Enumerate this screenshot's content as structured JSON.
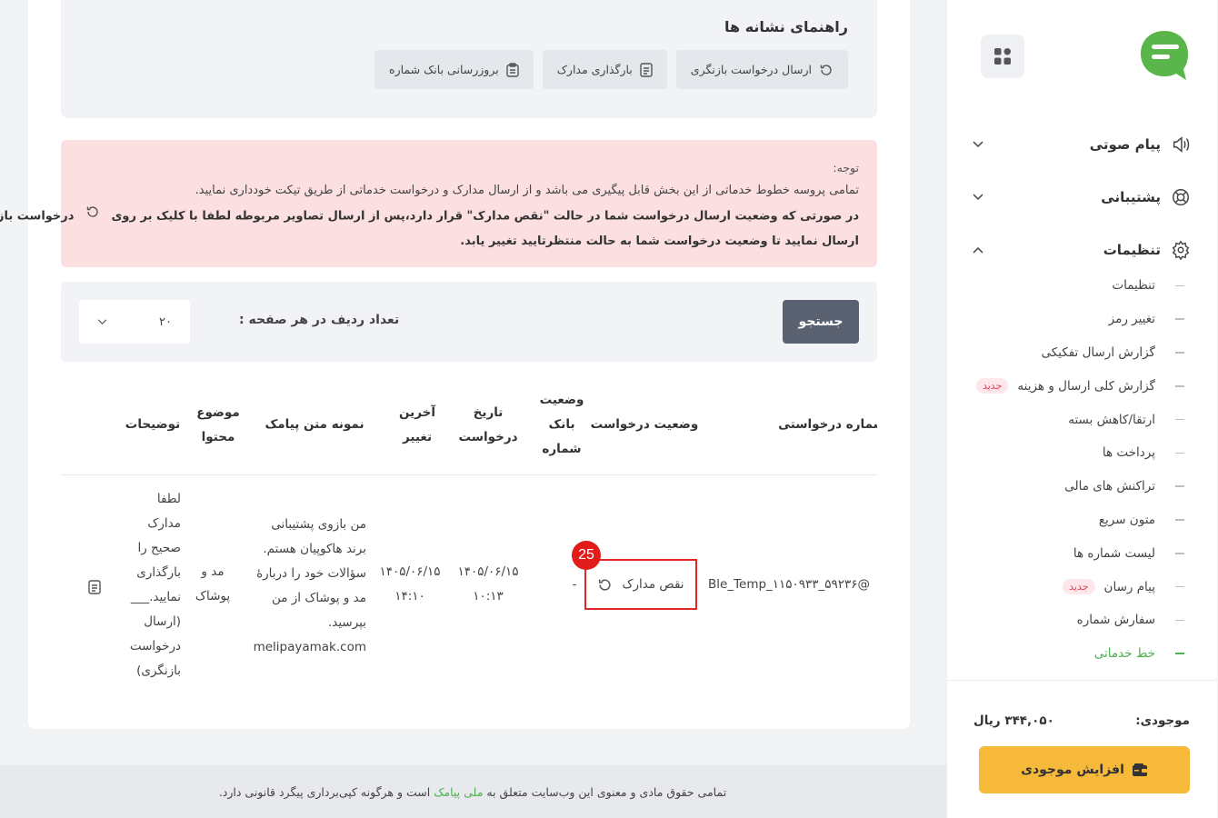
{
  "sidebar": {
    "menu": [
      {
        "label": "پیام صوتی",
        "icon": "speaker-icon"
      },
      {
        "label": "پشتیبانی",
        "icon": "lifebuoy-icon"
      },
      {
        "label": "تنظیمات",
        "icon": "gear-icon"
      }
    ],
    "submenu": [
      {
        "label": "تنظیمات"
      },
      {
        "label": "تغییر رمز"
      },
      {
        "label": "گزارش ارسال تفکیکی"
      },
      {
        "label": "گزارش کلی ارسال و هزینه",
        "badge": "جدید"
      },
      {
        "label": "ارتقا/کاهش بسته"
      },
      {
        "label": "پرداخت ها"
      },
      {
        "label": "تراکنش های مالی"
      },
      {
        "label": "متون سریع"
      },
      {
        "label": "لیست شماره ها"
      },
      {
        "label": "پیام رسان",
        "badge": "جدید"
      },
      {
        "label": "سفارش شماره"
      },
      {
        "label": "خط خدماتی",
        "active": true
      }
    ],
    "balance_label": "موجودی:",
    "balance_value": "۳۴۴,۰۵۰ ریال",
    "topup_label": "افزایش موجودی"
  },
  "guide": {
    "title": "راهنمای نشانه ها",
    "buttons": [
      {
        "label": "ارسال درخواست بازنگری",
        "icon": "refresh-icon"
      },
      {
        "label": "بارگذاری مدارک",
        "icon": "document-icon"
      },
      {
        "label": "بروزرسانی بانک شماره",
        "icon": "clipboard-icon"
      }
    ]
  },
  "alert": {
    "title": "توجه:",
    "line1": "تمامی پروسه خطوط خدماتی از این بخش قابل پیگیری می باشد و از ارسال مدارک و درخواست خدماتی از طریق تیکت خودداری نمایید.",
    "line2a": "در صورتی که وضعیت ارسال درخواست شما در حالت \"نقص مدارک\" قرار دارد،پس از ارسال تصاویر مربوطه لطفا با کلیک بر روی",
    "line2b": "درخواست بازنگری را",
    "line3": "ارسال نمایید تا وضعیت درخواست شما به حالت منتظرتایید تغییر یابد."
  },
  "filter": {
    "search_label": "جستجو",
    "rows_label": "تعداد ردیف در هر صفحه :",
    "rows_value": "۲۰"
  },
  "table": {
    "headers": {
      "request_no": "شماره درخواستی",
      "status": "وضعیت درخواست",
      "bank_status_1": "وضعیت",
      "bank_status_2": "بانک",
      "bank_status_3": "شماره",
      "req_date_1": "تاریخ",
      "req_date_2": "درخواست",
      "last_change_1": "آخرین",
      "last_change_2": "تغییر",
      "sample_text": "نمونه متن پیامک",
      "subject_1": "موضوع",
      "subject_2": "محتوا",
      "notes": "توضیحات"
    },
    "row": {
      "request_no": "Ble_Temp_۱۱۵۰۹۳۳_۵۹۲۳۶@",
      "status": "نقص مدارک",
      "bank_status": "-",
      "req_date_1": "۱۴۰۵/۰۶/۱۵",
      "req_date_2": "۱۰:۱۳",
      "last_change_1": "۱۴۰۵/۰۶/۱۵",
      "last_change_2": "۱۴:۱۰",
      "sample_1": "من بازوی پشتیبانی",
      "sample_2": "برند هاکوپیان هستم.",
      "sample_3": "سؤالات خود را دربارهٔ",
      "sample_4": "مد و پوشاک از من",
      "sample_5": "بپرسید.",
      "sample_6": "melipayamak.com",
      "subject_1": "مد و",
      "subject_2": "پوشاک",
      "notes_1": "لطفا",
      "notes_2": "مدارک",
      "notes_3": "صحیح را",
      "notes_4": "بارگذاری",
      "notes_5": "نمایید.___",
      "notes_6": "(ارسال",
      "notes_7": "درخواست",
      "notes_8": "بازنگری)"
    },
    "step_badge": "25"
  },
  "footer": {
    "text_a": "تمامی حقوق مادی و معنوی این وب‌سایت متعلق به",
    "brand": "ملی پیامک",
    "text_b": "است و هرگونه کپی‌برداری پیگرد قانونی دارد."
  },
  "colors": {
    "accent_green": "#4caf50",
    "topup_yellow": "#f7b93a",
    "alert_bg": "#fbdfe1",
    "highlight_red": "#e02828"
  }
}
